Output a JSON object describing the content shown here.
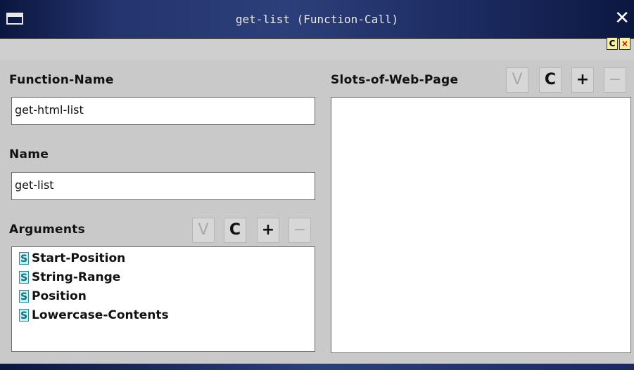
{
  "window": {
    "title": "get-list (Function-Call)",
    "close_glyph": "✕"
  },
  "toolbar": {
    "c_label": "C",
    "x_label": "×"
  },
  "function_name": {
    "label": "Function-Name",
    "value": "get-html-list"
  },
  "name": {
    "label": "Name",
    "value": "get-list"
  },
  "arguments": {
    "label": "Arguments",
    "buttons": {
      "v": "V",
      "c": "C",
      "plus": "+",
      "minus": "−"
    },
    "items": [
      {
        "type": "S",
        "label": "Start-Position"
      },
      {
        "type": "S",
        "label": "String-Range"
      },
      {
        "type": "S",
        "label": "Position"
      },
      {
        "type": "S",
        "label": "Lowercase-Contents"
      }
    ]
  },
  "slots": {
    "label": "Slots-of-Web-Page",
    "buttons": {
      "v": "V",
      "c": "C",
      "plus": "+",
      "minus": "−"
    }
  },
  "icons": {
    "window_menu": "window-menu-icon",
    "close": "close-icon",
    "slot": "slot-type-icon"
  }
}
